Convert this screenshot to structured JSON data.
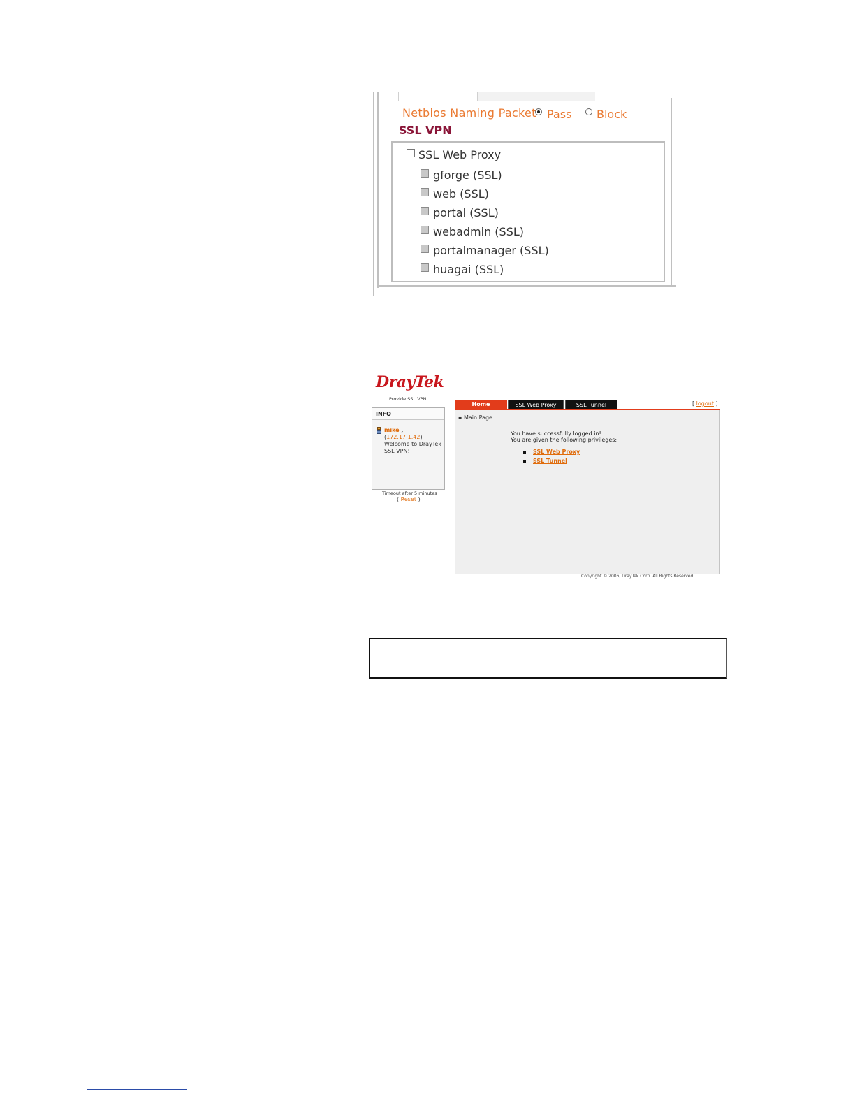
{
  "screenshot_settings": {
    "netbios_label": "Netbios Naming Packet",
    "netbios_options": [
      {
        "label": "Pass",
        "selected": true
      },
      {
        "label": "Block",
        "selected": false
      }
    ],
    "section_title": "SSL VPN",
    "web_proxy_label": "SSL Web Proxy",
    "web_proxy_checked": false,
    "proxy_items": [
      {
        "label": "gforge (SSL)",
        "checked": false
      },
      {
        "label": "web (SSL)",
        "checked": false
      },
      {
        "label": "portal (SSL)",
        "checked": false
      },
      {
        "label": "webadmin (SSL)",
        "checked": false
      },
      {
        "label": "portalmanager (SSL)",
        "checked": false
      },
      {
        "label": "huagai (SSL)",
        "checked": false
      }
    ],
    "colors": {
      "label_orange": "#ea7a32",
      "title_maroon": "#8a1538"
    }
  },
  "screenshot_vpn": {
    "logo": "DrayTek",
    "tagline": "Provide SSL VPN",
    "info": {
      "title": "INFO",
      "username": "mike",
      "username_suffix": " ,",
      "ip_open": "(",
      "ip": "172.17.1.42",
      "ip_close": ")",
      "welcome": "Welcome to DrayTek SSL VPN!"
    },
    "timeout_text": "Timeout after 5 minutes",
    "reset": {
      "open": "( ",
      "label": "Reset",
      "close": " )"
    },
    "tabs": [
      {
        "label": "Home",
        "active": true
      },
      {
        "label": "SSL Web Proxy",
        "active": false
      },
      {
        "label": "SSL Tunnel",
        "active": false
      }
    ],
    "logout": {
      "open": "[ ",
      "label": "logout",
      "close": " ]"
    },
    "breadcrumb": "Main Page:",
    "message_line1": "You have successfully logged in!",
    "message_line2": "You are given the following privileges:",
    "privileges": [
      "SSL Web Proxy",
      "SSL Tunnel"
    ],
    "copyright": "Copyright © 2006, DrayTek Corp. All Rights Reserved.",
    "colors": {
      "logo_red": "#c8161d",
      "tab_active": "#e23c1b",
      "tab_inactive": "#111111",
      "link_orange": "#e06c0c"
    }
  }
}
